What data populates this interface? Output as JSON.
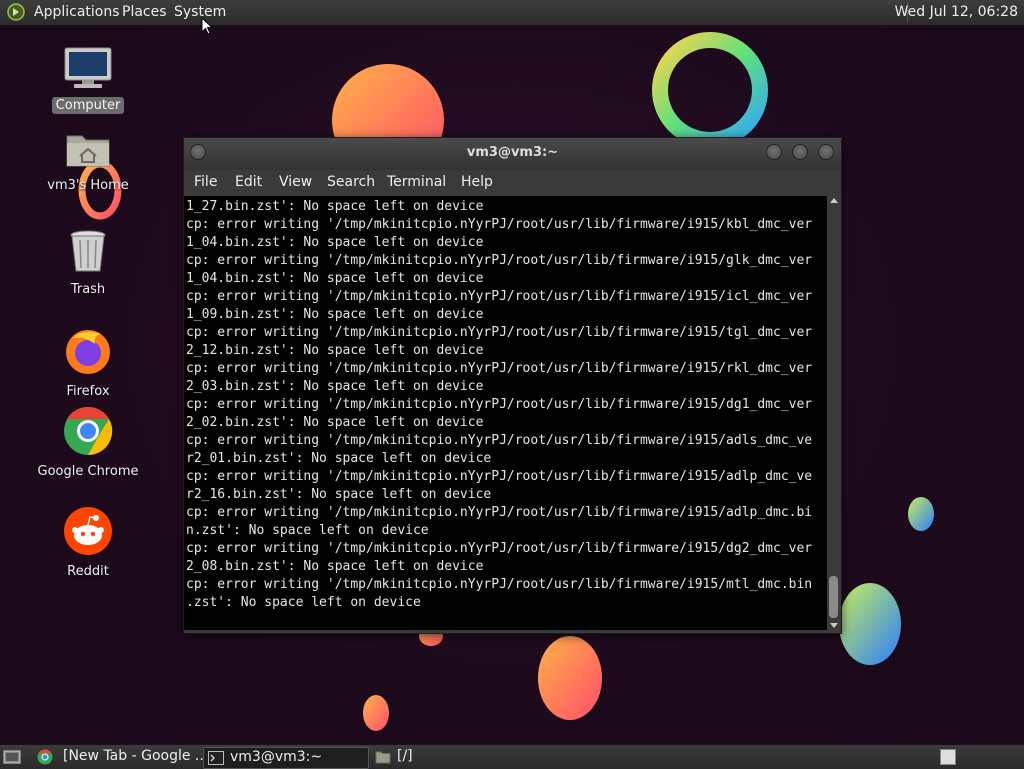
{
  "top_panel": {
    "menus": [
      "Applications",
      "Places",
      "System"
    ],
    "clock": "Wed Jul 12, 06:28"
  },
  "desktop": {
    "icons": [
      {
        "label": "Computer",
        "icon": "computer-icon"
      },
      {
        "label": "vm3's Home",
        "icon": "home-folder-icon"
      },
      {
        "label": "Trash",
        "icon": "trash-icon"
      },
      {
        "label": "Firefox",
        "icon": "firefox-icon"
      },
      {
        "label": "Google Chrome",
        "icon": "chrome-icon"
      },
      {
        "label": "Reddit",
        "icon": "reddit-icon"
      }
    ]
  },
  "terminal": {
    "title": "vm3@vm3:~",
    "menus": [
      "File",
      "Edit",
      "View",
      "Search",
      "Terminal",
      "Help"
    ],
    "lines": [
      "1_27.bin.zst': No space left on device",
      "cp: error writing '/tmp/mkinitcpio.nYyrPJ/root/usr/lib/firmware/i915/kbl_dmc_ver",
      "1_04.bin.zst': No space left on device",
      "cp: error writing '/tmp/mkinitcpio.nYyrPJ/root/usr/lib/firmware/i915/glk_dmc_ver",
      "1_04.bin.zst': No space left on device",
      "cp: error writing '/tmp/mkinitcpio.nYyrPJ/root/usr/lib/firmware/i915/icl_dmc_ver",
      "1_09.bin.zst': No space left on device",
      "cp: error writing '/tmp/mkinitcpio.nYyrPJ/root/usr/lib/firmware/i915/tgl_dmc_ver",
      "2_12.bin.zst': No space left on device",
      "cp: error writing '/tmp/mkinitcpio.nYyrPJ/root/usr/lib/firmware/i915/rkl_dmc_ver",
      "2_03.bin.zst': No space left on device",
      "cp: error writing '/tmp/mkinitcpio.nYyrPJ/root/usr/lib/firmware/i915/dg1_dmc_ver",
      "2_02.bin.zst': No space left on device",
      "cp: error writing '/tmp/mkinitcpio.nYyrPJ/root/usr/lib/firmware/i915/adls_dmc_ve",
      "r2_01.bin.zst': No space left on device",
      "cp: error writing '/tmp/mkinitcpio.nYyrPJ/root/usr/lib/firmware/i915/adlp_dmc_ve",
      "r2_16.bin.zst': No space left on device",
      "cp: error writing '/tmp/mkinitcpio.nYyrPJ/root/usr/lib/firmware/i915/adlp_dmc.bi",
      "n.zst': No space left on device",
      "cp: error writing '/tmp/mkinitcpio.nYyrPJ/root/usr/lib/firmware/i915/dg2_dmc_ver",
      "2_08.bin.zst': No space left on device",
      "cp: error writing '/tmp/mkinitcpio.nYyrPJ/root/usr/lib/firmware/i915/mtl_dmc.bin",
      ".zst': No space left on device"
    ]
  },
  "taskbar": {
    "tasks": [
      {
        "label": "[New Tab - Google ...",
        "icon": "chrome-icon"
      },
      {
        "label": "vm3@vm3:~",
        "icon": "terminal-icon"
      },
      {
        "label": "[/]",
        "icon": "folder-icon"
      }
    ]
  }
}
